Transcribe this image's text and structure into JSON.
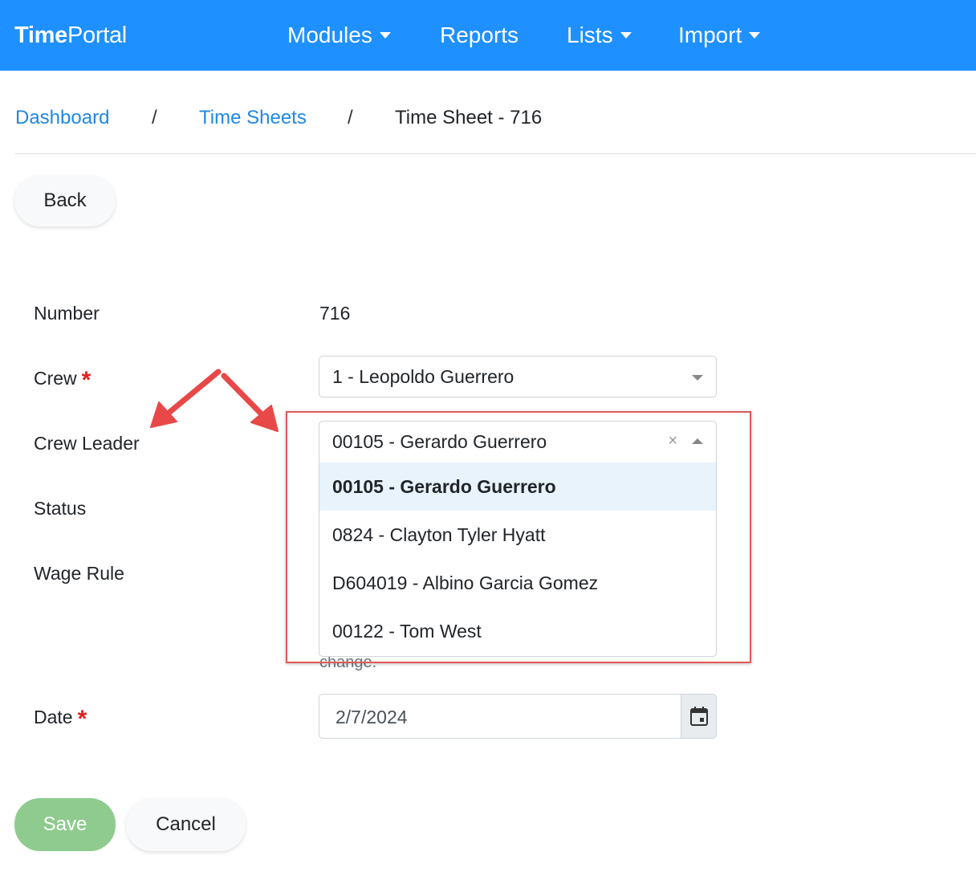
{
  "navbar": {
    "brand_bold": "Time",
    "brand_rest": "Portal",
    "items": [
      {
        "label": "Modules",
        "has_caret": true
      },
      {
        "label": "Reports",
        "has_caret": false
      },
      {
        "label": "Lists",
        "has_caret": true
      },
      {
        "label": "Import",
        "has_caret": true
      }
    ]
  },
  "breadcrumb": {
    "items": [
      "Dashboard",
      "Time Sheets",
      "Time Sheet - 716"
    ],
    "separator": "/"
  },
  "actions": {
    "back_label": "Back",
    "save_label": "Save",
    "cancel_label": "Cancel"
  },
  "form": {
    "number": {
      "label": "Number",
      "value": "716"
    },
    "crew": {
      "label": "Crew",
      "required_mark": "*",
      "value": "1 - Leopoldo Guerrero"
    },
    "crew_leader": {
      "label": "Crew Leader",
      "value": "00105 - Gerardo Guerrero",
      "clear_glyph": "×",
      "options": [
        "00105 - Gerardo Guerrero",
        "0824 - Clayton Tyler Hyatt",
        "D604019 - Albino Garcia Gomez",
        "00122 - Tom West"
      ]
    },
    "status": {
      "label": "Status"
    },
    "wage_rule": {
      "label": "Wage Rule",
      "help_fragment": "change."
    },
    "date": {
      "label": "Date",
      "required_mark": "*",
      "value": "2/7/2024"
    }
  },
  "colors": {
    "navbar": "#1e90ff",
    "link": "#1e88e5",
    "required": "#e02020",
    "save_button": "#8fcb8f",
    "annotation": "#e05a5a"
  },
  "icons": {
    "date_picker": "calendar-icon"
  }
}
